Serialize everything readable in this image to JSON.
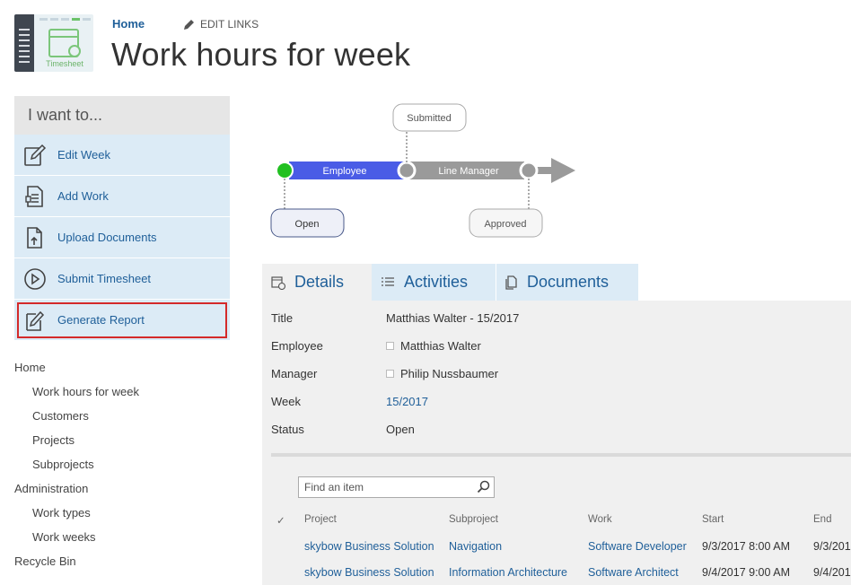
{
  "header": {
    "logo_text": "Timesheet",
    "home_link": "Home",
    "edit_links": "EDIT LINKS",
    "page_title": "Work hours for week"
  },
  "actions": {
    "title": "I want to...",
    "items": [
      {
        "label": "Edit Week",
        "icon": "edit-icon"
      },
      {
        "label": "Add Work",
        "icon": "document-list-icon"
      },
      {
        "label": "Upload Documents",
        "icon": "upload-document-icon"
      },
      {
        "label": "Submit Timesheet",
        "icon": "play-circle-icon"
      },
      {
        "label": "Generate Report",
        "icon": "report-edit-icon"
      }
    ]
  },
  "nav": {
    "home": "Home",
    "home_children": [
      "Work hours for week",
      "Customers",
      "Projects",
      "Subprojects"
    ],
    "admin": "Administration",
    "admin_children": [
      "Work types",
      "Work weeks"
    ],
    "recycle": "Recycle Bin"
  },
  "workflow": {
    "steps": [
      "Employee",
      "Line Manager"
    ],
    "states": {
      "submitted": "Submitted",
      "open": "Open",
      "approved": "Approved"
    },
    "colors": {
      "employee": "#4a5ce6",
      "manager": "#9a9a9a",
      "start_dot": "#22c022",
      "dot": "#9a9a9a"
    }
  },
  "tabs": [
    {
      "label": "Details",
      "icon": "calendar-clock-icon"
    },
    {
      "label": "Activities",
      "icon": "list-icon"
    },
    {
      "label": "Documents",
      "icon": "documents-icon"
    }
  ],
  "details": {
    "title_label": "Title",
    "title_value": "Matthias Walter - 15/2017",
    "employee_label": "Employee",
    "employee_value": "Matthias Walter",
    "manager_label": "Manager",
    "manager_value": "Philip Nussbaumer",
    "week_label": "Week",
    "week_value": "15/2017",
    "status_label": "Status",
    "status_value": "Open"
  },
  "search": {
    "placeholder": "Find an item"
  },
  "table": {
    "columns": [
      "✓",
      "Project",
      "Subproject",
      "Work",
      "Start",
      "End"
    ],
    "rows": [
      [
        "skybow Business Solution",
        "Navigation",
        "Software Developer",
        "9/3/2017 8:00 AM",
        "9/3/201"
      ],
      [
        "skybow Business Solution",
        "Information Architecture",
        "Software Architect",
        "9/4/2017 9:00 AM",
        "9/4/201"
      ]
    ]
  },
  "colors": {
    "accent": "#1f5f99",
    "panel": "#dcebf6",
    "highlight_border": "#d42a2a"
  }
}
